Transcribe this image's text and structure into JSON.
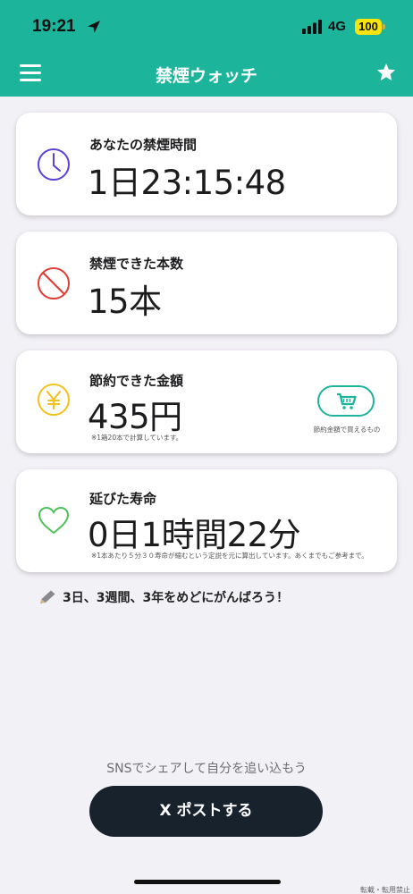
{
  "status_bar": {
    "time": "19:21",
    "network": "4G",
    "battery": "100"
  },
  "nav": {
    "title": "禁煙ウォッチ",
    "menu_icon": "hamburger-menu-icon",
    "favorite_icon": "star-icon"
  },
  "cards": {
    "time": {
      "label": "あなたの禁煙時間",
      "value": "1日23:15:48",
      "icon": "clock-icon",
      "icon_color": "#5b3fd9"
    },
    "count": {
      "label": "禁煙できた本数",
      "value": "15本",
      "icon": "prohibited-icon",
      "icon_color": "#e53935"
    },
    "money": {
      "label": "節約できた金額",
      "value": "435円",
      "note": "※1箱20本で計算しています。",
      "icon": "yen-icon",
      "icon_color": "#f2c21b",
      "cart_icon": "shopping-cart-icon",
      "cart_caption": "節約金額で買えるもの"
    },
    "life": {
      "label": "延びた寿命",
      "value": "0日1時間22分",
      "note": "※1本あたり５分３０寿命が縮むという定説を元に算出しています。あくまでもご参考まで。",
      "icon": "heart-icon",
      "icon_color": "#4cc05a"
    }
  },
  "encouragement": {
    "icon": "pencil-icon",
    "text": "3日、3週間、3年をめどにがんばろう！"
  },
  "share": {
    "caption": "SNSでシェアして自分を追い込もう",
    "button_label": "X ポストする"
  },
  "footer": {
    "copyright": "転載・転用禁止"
  },
  "colors": {
    "accent": "#1db49c",
    "button_dark": "#17222d",
    "background": "#f2f1f6"
  }
}
